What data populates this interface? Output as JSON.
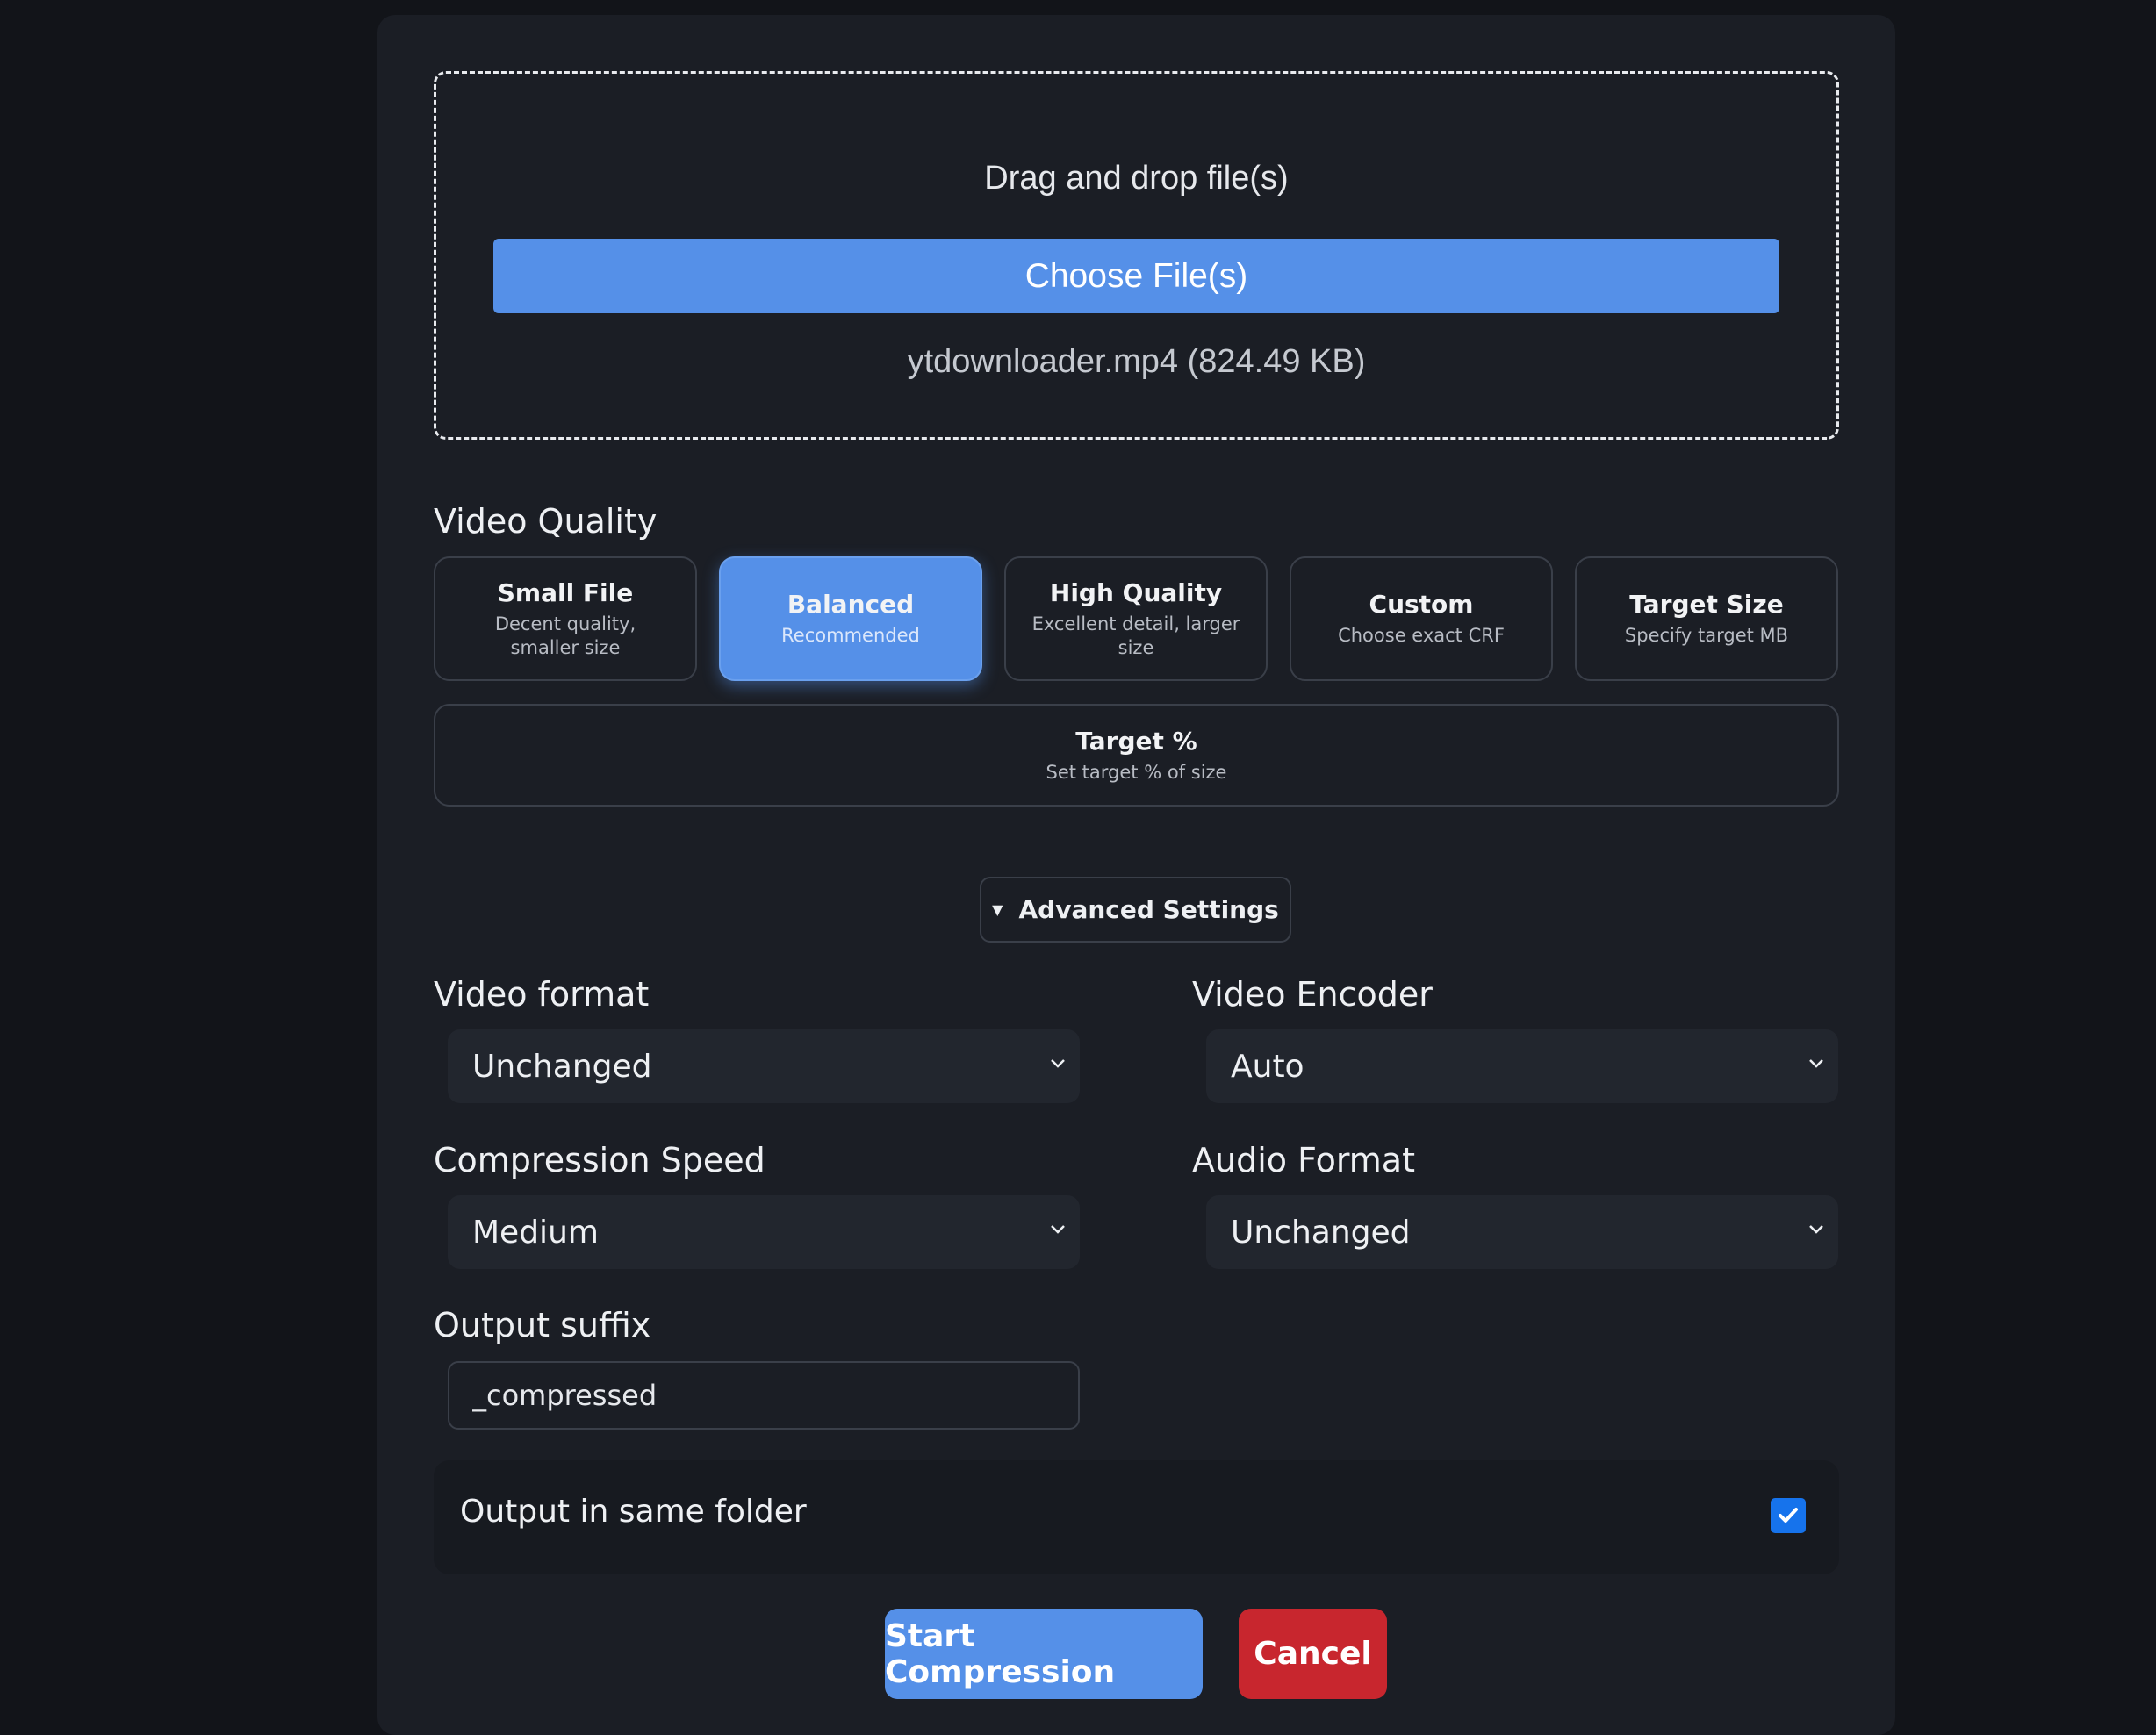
{
  "upload": {
    "drop_title": "Drag and drop file(s)",
    "choose_button": "Choose File(s)",
    "file_info": "ytdownloader.mp4 (824.49 KB)"
  },
  "quality": {
    "label": "Video Quality",
    "options": [
      {
        "title": "Small File",
        "desc": "Decent quality, smaller size",
        "selected": false
      },
      {
        "title": "Balanced",
        "desc": "Recommended",
        "selected": true
      },
      {
        "title": "High Quality",
        "desc": "Excellent detail, larger size",
        "selected": false
      },
      {
        "title": "Custom",
        "desc": "Choose exact CRF",
        "selected": false
      },
      {
        "title": "Target Size",
        "desc": "Specify target MB",
        "selected": false
      },
      {
        "title": "Target %",
        "desc": "Set target % of size",
        "selected": false
      }
    ]
  },
  "advanced": {
    "toggle_label": "Advanced Settings"
  },
  "settings": {
    "video_format": {
      "label": "Video format",
      "value": "Unchanged"
    },
    "video_encoder": {
      "label": "Video Encoder",
      "value": "Auto"
    },
    "compression_speed": {
      "label": "Compression Speed",
      "value": "Medium"
    },
    "audio_format": {
      "label": "Audio Format",
      "value": "Unchanged"
    },
    "output_suffix": {
      "label": "Output suffix",
      "value": "_compressed"
    },
    "same_folder": {
      "label": "Output in same folder",
      "checked": true
    }
  },
  "actions": {
    "start": "Start Compression",
    "cancel": "Cancel"
  },
  "colors": {
    "accent": "#5590e8",
    "danger": "#c8262e",
    "background": "#121419",
    "panel": "#1b1e25"
  }
}
